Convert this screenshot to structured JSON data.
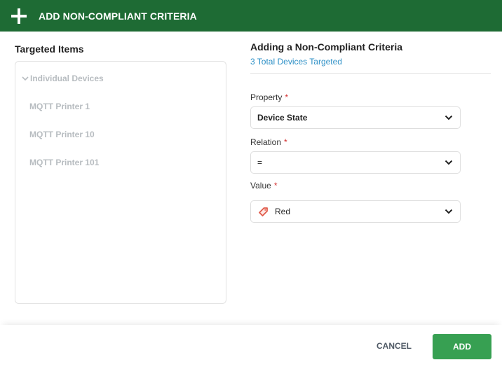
{
  "header": {
    "icon": "plus-icon",
    "title": "ADD NON-COMPLIANT CRITERIA"
  },
  "targeted": {
    "title": "Targeted Items",
    "group": {
      "label": "Individual Devices",
      "icon": "chevron-down-icon",
      "expanded": true
    },
    "items": [
      "MQTT Printer 1",
      "MQTT Printer 10",
      "MQTT Printer 101"
    ]
  },
  "form": {
    "title": "Adding a Non-Compliant Criteria",
    "subtitle": "3 Total Devices Targeted",
    "required_mark": "*",
    "fields": [
      {
        "label": "Property",
        "value": "Device State"
      },
      {
        "label": "Relation",
        "value": "="
      },
      {
        "label": "Value",
        "value": "Red",
        "icon": "tag-icon"
      }
    ]
  },
  "footer": {
    "cancel_label": "CANCEL",
    "add_label": "ADD"
  },
  "colors": {
    "header_bg": "#1e6b34",
    "primary_button": "#37a052",
    "link": "#2b8fc6",
    "required": "#d32f2f",
    "tag": "#e05a4a"
  }
}
